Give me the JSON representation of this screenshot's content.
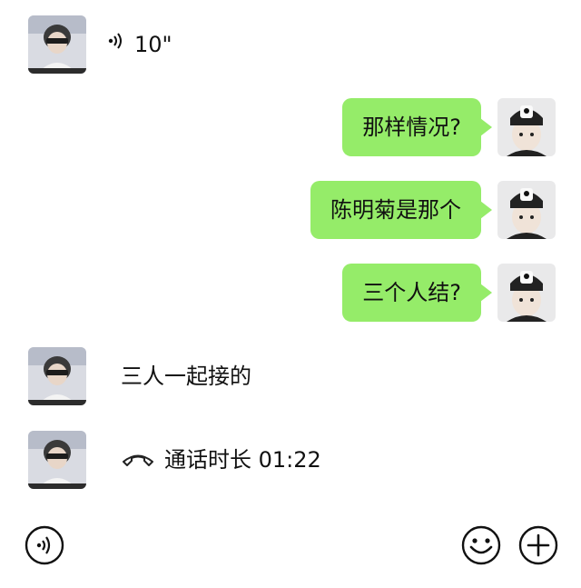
{
  "messages": [
    {
      "side": "left",
      "kind": "voice",
      "text": "10\"",
      "avatar": "avatar-friend"
    },
    {
      "side": "right",
      "kind": "text",
      "text": "那样情况?",
      "avatar": "avatar-me"
    },
    {
      "side": "right",
      "kind": "text",
      "text": "陈明菊是那个",
      "avatar": "avatar-me"
    },
    {
      "side": "right",
      "kind": "text",
      "text": "三个人结?",
      "avatar": "avatar-me"
    },
    {
      "side": "left",
      "kind": "text",
      "text": "三人一起接的",
      "avatar": "avatar-friend"
    },
    {
      "side": "left",
      "kind": "call",
      "text": "通话时长 01:22",
      "avatar": "avatar-friend"
    }
  ],
  "toolbar": {
    "icons": [
      "voice-input-icon",
      "emoji-icon",
      "add-icon"
    ]
  },
  "colors": {
    "bubble_green": "#95ec69",
    "background": "#ffffff"
  }
}
